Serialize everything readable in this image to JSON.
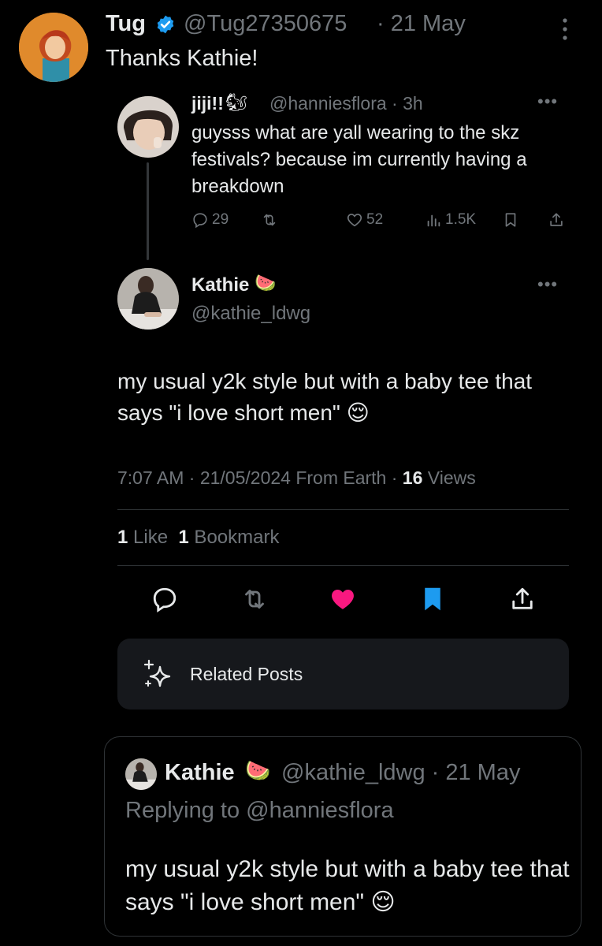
{
  "main_tweet": {
    "name": "Tug",
    "handle": "@Tug27350675",
    "date": "· 21 May",
    "text": "Thanks Kathie!"
  },
  "quoted_tweet": {
    "name": "jiji!!",
    "emoji": "🐿",
    "handle": "@hanniesflora · 3h",
    "text": "guysss what are yall wearing to the skz festivals? because im currently having a breakdown",
    "replies": "29",
    "likes": "52",
    "views": "1.5K"
  },
  "reply_tweet": {
    "name": "Kathie",
    "emoji": "🍉",
    "handle": "@kathie_ldwg",
    "text": "my usual y2k style but with a baby tee that says \"i love short men\" 😌",
    "meta_prefix": "7:07 AM · 21/05/2024 From Earth · ",
    "views_count": "16",
    "views_label": " Views",
    "likes_count": "1",
    "likes_label": " Like",
    "bookmarks_count": "1",
    "bookmarks_label": " Bookmark"
  },
  "related": {
    "label": "Related Posts"
  },
  "embedded_card": {
    "name": "Kathie",
    "emoji": "🍉",
    "handle": "@kathie_ldwg · 21 May",
    "replying_to": "Replying to @hanniesflora",
    "text": "my usual y2k style but with a baby tee that says \"i love short men\" 😌"
  },
  "colors": {
    "background": "#000000",
    "text": "#e7e9ea",
    "muted": "#71767b",
    "verified": "#1d9bf0",
    "like_active": "#f91880",
    "bookmark_active": "#1d9bf0"
  },
  "icons": [
    "verified-badge-icon",
    "more-vertical-icon",
    "more-horizontal-icon",
    "reply-icon",
    "retweet-icon",
    "like-icon",
    "views-icon",
    "bookmark-icon",
    "share-icon",
    "sparkle-icon"
  ]
}
